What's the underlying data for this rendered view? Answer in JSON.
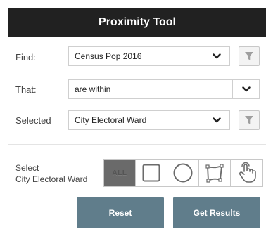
{
  "header": {
    "title": "Proximity Tool"
  },
  "find": {
    "label": "Find:",
    "value": "Census Pop 2016"
  },
  "that": {
    "label": "That:",
    "value": "are within"
  },
  "selected": {
    "label": "Selected",
    "value": "City Electoral Ward"
  },
  "selection": {
    "label_line1": "Select",
    "label_line2": "City Electoral Ward",
    "tools": [
      {
        "label": "ALL",
        "icon": "all-icon"
      },
      {
        "icon": "rectangle-select-icon"
      },
      {
        "icon": "circle-select-icon"
      },
      {
        "icon": "polygon-select-icon"
      },
      {
        "icon": "hand-click-icon"
      }
    ]
  },
  "buttons": {
    "reset": "Reset",
    "get_results": "Get Results"
  },
  "colors": {
    "header_bg": "#212121",
    "button_bg": "#607d8b",
    "all_tool_bg": "#6a6a6a"
  }
}
